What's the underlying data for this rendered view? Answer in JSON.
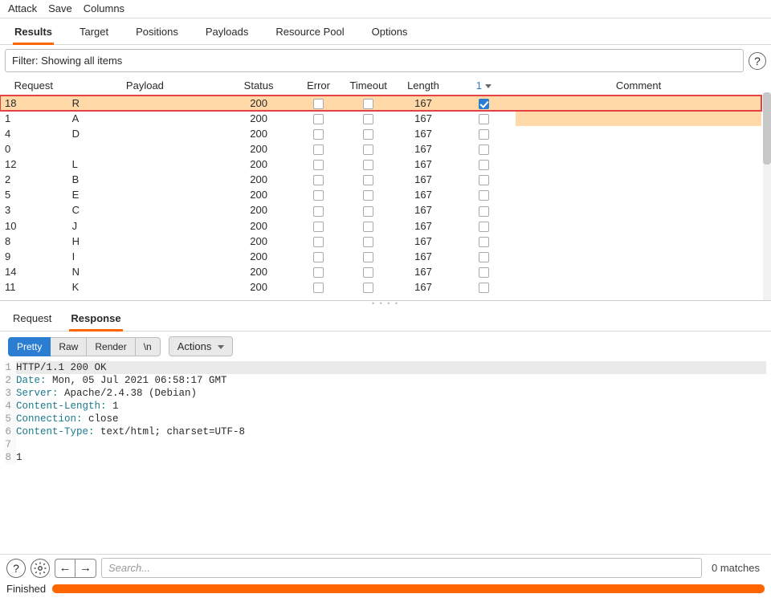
{
  "menubar": {
    "items": [
      "Attack",
      "Save",
      "Columns"
    ]
  },
  "primary_tabs": {
    "items": [
      "Results",
      "Target",
      "Positions",
      "Payloads",
      "Resource Pool",
      "Options"
    ],
    "active": 0
  },
  "filter": {
    "text": "Filter: Showing all items"
  },
  "table": {
    "columns": [
      "Request",
      "Payload",
      "Status",
      "Error",
      "Timeout",
      "Length",
      "1",
      "Comment"
    ],
    "sort_column_index": 6,
    "rows": [
      {
        "request": "18",
        "payload": "R",
        "status": "200",
        "error": false,
        "timeout": false,
        "length": "167",
        "grep1": true,
        "comment": "",
        "highlight": true
      },
      {
        "request": "1",
        "payload": "A",
        "status": "200",
        "error": false,
        "timeout": false,
        "length": "167",
        "grep1": false,
        "comment": "",
        "trail_highlight": true
      },
      {
        "request": "4",
        "payload": "D",
        "status": "200",
        "error": false,
        "timeout": false,
        "length": "167",
        "grep1": false,
        "comment": ""
      },
      {
        "request": "0",
        "payload": "",
        "status": "200",
        "error": false,
        "timeout": false,
        "length": "167",
        "grep1": false,
        "comment": ""
      },
      {
        "request": "12",
        "payload": "L",
        "status": "200",
        "error": false,
        "timeout": false,
        "length": "167",
        "grep1": false,
        "comment": ""
      },
      {
        "request": "2",
        "payload": "B",
        "status": "200",
        "error": false,
        "timeout": false,
        "length": "167",
        "grep1": false,
        "comment": ""
      },
      {
        "request": "5",
        "payload": "E",
        "status": "200",
        "error": false,
        "timeout": false,
        "length": "167",
        "grep1": false,
        "comment": ""
      },
      {
        "request": "3",
        "payload": "C",
        "status": "200",
        "error": false,
        "timeout": false,
        "length": "167",
        "grep1": false,
        "comment": ""
      },
      {
        "request": "10",
        "payload": "J",
        "status": "200",
        "error": false,
        "timeout": false,
        "length": "167",
        "grep1": false,
        "comment": ""
      },
      {
        "request": "8",
        "payload": "H",
        "status": "200",
        "error": false,
        "timeout": false,
        "length": "167",
        "grep1": false,
        "comment": ""
      },
      {
        "request": "9",
        "payload": "I",
        "status": "200",
        "error": false,
        "timeout": false,
        "length": "167",
        "grep1": false,
        "comment": ""
      },
      {
        "request": "14",
        "payload": "N",
        "status": "200",
        "error": false,
        "timeout": false,
        "length": "167",
        "grep1": false,
        "comment": ""
      },
      {
        "request": "11",
        "payload": "K",
        "status": "200",
        "error": false,
        "timeout": false,
        "length": "167",
        "grep1": false,
        "comment": ""
      }
    ]
  },
  "sub_tabs": {
    "items": [
      "Request",
      "Response"
    ],
    "active": 1
  },
  "view_modes": {
    "items": [
      "Pretty",
      "Raw",
      "Render",
      "\\n"
    ],
    "active": 0
  },
  "actions_label": "Actions",
  "response_lines": [
    {
      "n": "1",
      "text": "HTTP/1.1 200 OK",
      "selected": true
    },
    {
      "n": "2",
      "text_parts": [
        {
          "t": "Date:",
          "h": true
        },
        {
          "t": " Mon, 05 Jul 2021 06:58:17 GMT"
        }
      ]
    },
    {
      "n": "3",
      "text_parts": [
        {
          "t": "Server:",
          "h": true
        },
        {
          "t": " Apache/2.4.38 (Debian)"
        }
      ]
    },
    {
      "n": "4",
      "text_parts": [
        {
          "t": "Content-Length:",
          "h": true
        },
        {
          "t": " 1"
        }
      ]
    },
    {
      "n": "5",
      "text_parts": [
        {
          "t": "Connection:",
          "h": true
        },
        {
          "t": " close"
        }
      ]
    },
    {
      "n": "6",
      "text_parts": [
        {
          "t": "Content-Type:",
          "h": true
        },
        {
          "t": " text/html; charset=UTF-8"
        }
      ]
    },
    {
      "n": "7",
      "text": ""
    },
    {
      "n": "8",
      "text": "1"
    }
  ],
  "search": {
    "placeholder": "Search...",
    "matches_label": "0 matches"
  },
  "status": {
    "label": "Finished"
  }
}
